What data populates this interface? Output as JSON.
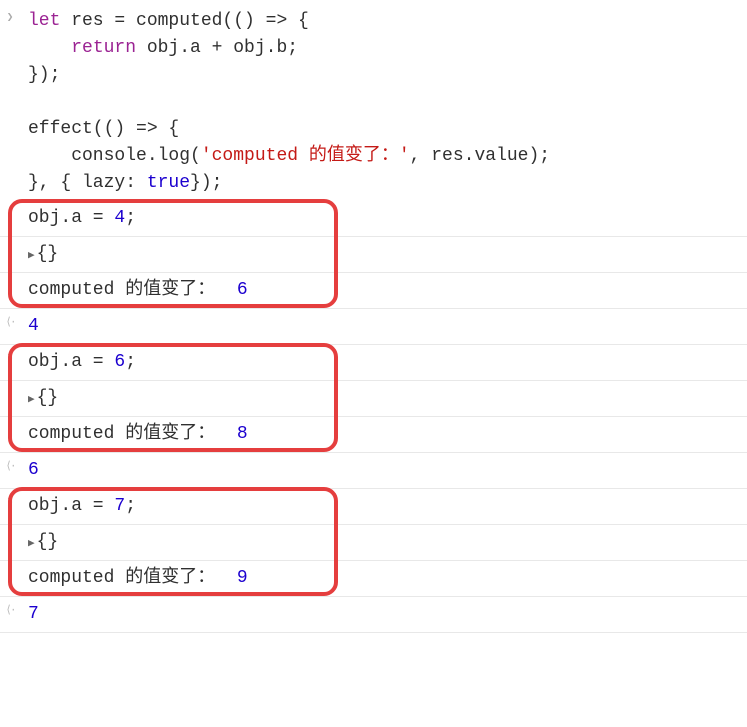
{
  "codeblock": {
    "line1_let": "let",
    "line1_rest": " res = computed(() => {",
    "line2_return": "return",
    "line2_rest": " obj.a + obj.b;",
    "line3": "});",
    "line5": "effect(() => {",
    "line6_pre": "    console.log(",
    "line6_str": "'computed 的值变了：'",
    "line6_mid": ", res.value);",
    "line7_pre": "}, { lazy: ",
    "line7_true": "true",
    "line7_post": "});"
  },
  "blocks": [
    {
      "assign": "obj.a = ",
      "assign_val": "4",
      "assign_post": ";",
      "obj_repr": "{}",
      "log_prefix": "computed 的值变了： ",
      "log_val": "6",
      "output_val": "4",
      "has_input_arrow": false
    },
    {
      "assign": "obj.a = ",
      "assign_val": "6",
      "assign_post": ";",
      "obj_repr": "{}",
      "log_prefix": "computed 的值变了： ",
      "log_val": "8",
      "output_val": "6",
      "has_input_arrow": true
    },
    {
      "assign": "obj.a = ",
      "assign_val": "7",
      "assign_post": ";",
      "obj_repr": "{}",
      "log_prefix": "computed 的值变了： ",
      "log_val": "9",
      "output_val": "7",
      "has_input_arrow": true
    }
  ]
}
